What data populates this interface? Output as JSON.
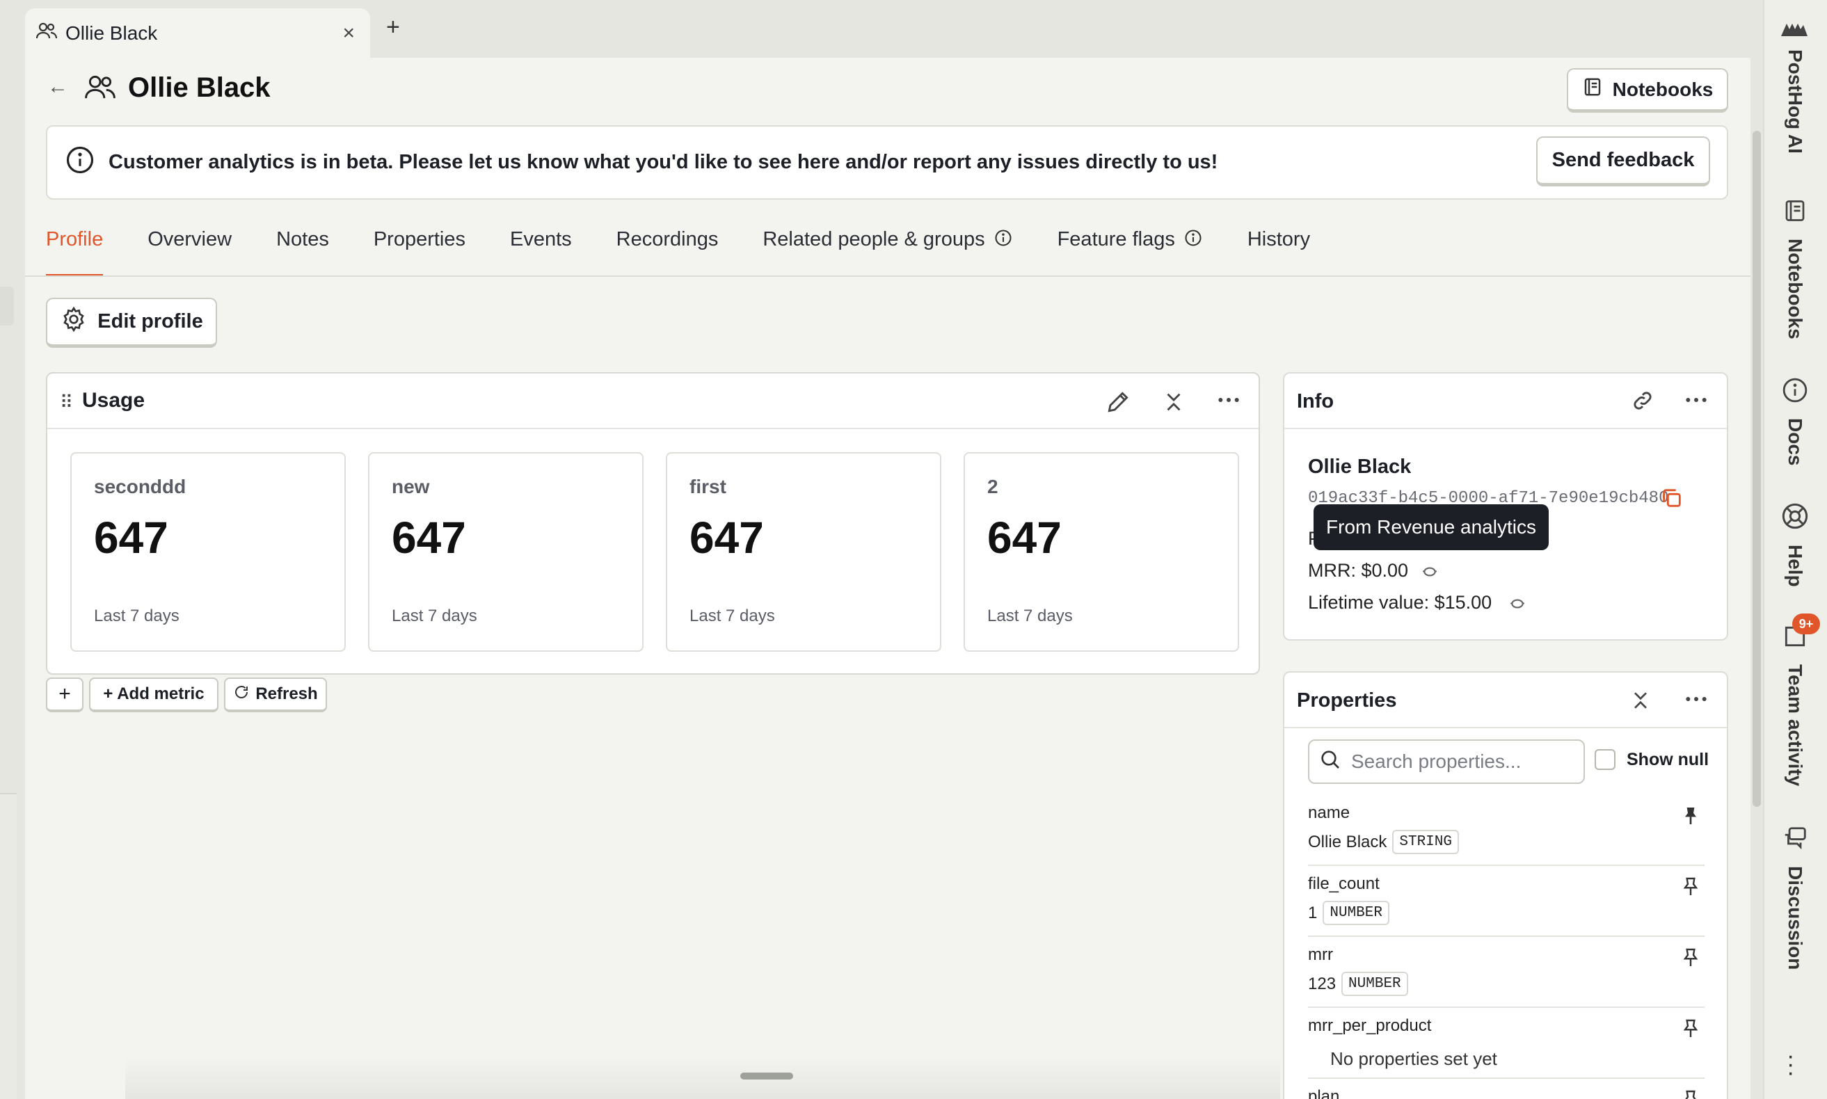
{
  "tab": {
    "title": "Ollie Black",
    "close": "×",
    "new": "+"
  },
  "header": {
    "back": "←",
    "title": "Ollie Black",
    "notebooks_label": "Notebooks"
  },
  "banner": {
    "message": "Customer analytics is in beta. Please let us know what you'd like to see here and/or report any issues directly to us!",
    "feedback_label": "Send feedback"
  },
  "tabs": [
    "Profile",
    "Overview",
    "Notes",
    "Properties",
    "Events",
    "Recordings",
    "Related people & groups",
    "Feature flags",
    "History"
  ],
  "active_tab": "Profile",
  "edit_profile_label": "Edit profile",
  "usage": {
    "title": "Usage",
    "metrics": [
      {
        "name": "seconddd",
        "value": "647",
        "period": "Last 7 days"
      },
      {
        "name": "new",
        "value": "647",
        "period": "Last 7 days"
      },
      {
        "name": "first",
        "value": "647",
        "period": "Last 7 days"
      },
      {
        "name": "2",
        "value": "647",
        "period": "Last 7 days"
      }
    ],
    "plus_label": "+",
    "add_metric_label": "+ Add metric",
    "refresh_label": "Refresh"
  },
  "info": {
    "title": "Info",
    "name": "Ollie Black",
    "id": "019ac33f-b4c5-0000-af71-7e90e19cb480",
    "hidden_line_prefix": "P",
    "mrr": "MRR: $0.00",
    "lifetime_value": "Lifetime value: $15.00",
    "tooltip": "From Revenue analytics"
  },
  "properties": {
    "title": "Properties",
    "search_placeholder": "Search properties...",
    "show_null_label": "Show null",
    "rows": [
      {
        "key": "name",
        "value": "Ollie Black",
        "type": "STRING"
      },
      {
        "key": "file_count",
        "value": "1",
        "type": "NUMBER"
      },
      {
        "key": "mrr",
        "value": "123",
        "type": "NUMBER"
      },
      {
        "key": "mrr_per_product",
        "value": "No properties set yet",
        "type": ""
      },
      {
        "key": "plan",
        "value": "",
        "type": ""
      }
    ]
  },
  "sidebar": {
    "items": [
      {
        "label": "PostHog AI",
        "icon": "hedgehog-icon"
      },
      {
        "label": "Notebooks",
        "icon": "notebook-icon"
      },
      {
        "label": "Docs",
        "icon": "info-icon"
      },
      {
        "label": "Help",
        "icon": "lifebuoy-icon"
      },
      {
        "label": "Team activity",
        "icon": "inbox-icon"
      },
      {
        "label": "Discussion",
        "icon": "chat-icon"
      }
    ],
    "badge": "9+"
  },
  "colors": {
    "accent": "#e0562a",
    "background": "#eeefe9",
    "tooltip": "#1d1f27"
  }
}
